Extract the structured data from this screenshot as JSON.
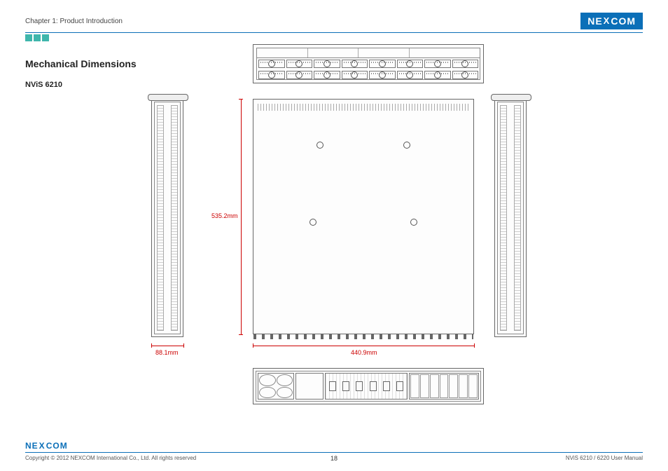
{
  "header": {
    "chapter": "Chapter 1: Product Introduction",
    "logo_text_left": "NE",
    "logo_text_x": "X",
    "logo_text_right": "COM"
  },
  "content": {
    "section_title": "Mechanical Dimensions",
    "subtitle": "NViS 6210"
  },
  "dimensions": {
    "depth": "535.2mm",
    "side_width": "88.1mm",
    "width": "440.9mm"
  },
  "footer": {
    "logo_text_left": "NE",
    "logo_text_x": "X",
    "logo_text_right": "COM",
    "copyright": "Copyright © 2012 NEXCOM International Co., Ltd. All rights reserved",
    "page_number": "18",
    "doc_title": "NViS 6210 / 6220 User Manual"
  }
}
